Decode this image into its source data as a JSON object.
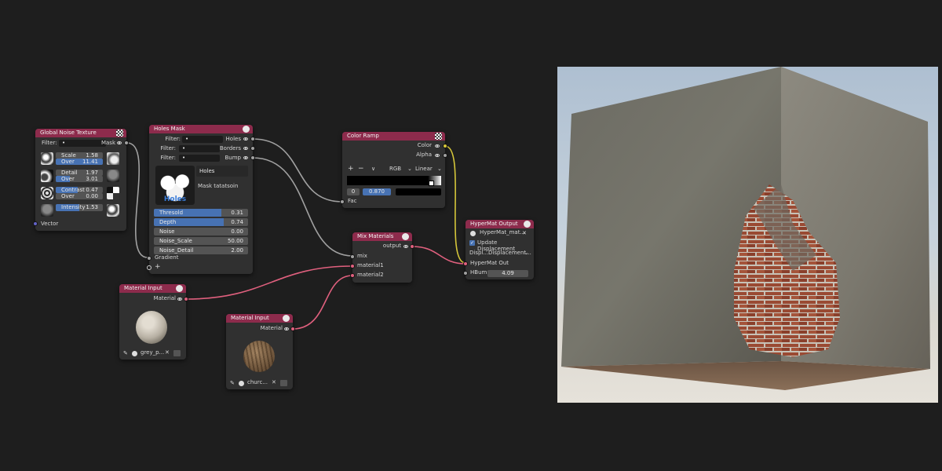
{
  "nodes": {
    "global_noise": {
      "title": "Global Noise Texture",
      "filter_label": "Filter:",
      "filter_value": "•",
      "mask_label": "Mask",
      "rows": [
        {
          "label1": "Scale",
          "value1": "1.58",
          "label2": "Over",
          "value2": "11.41"
        },
        {
          "label1": "Detail",
          "value1": "1.97",
          "label2": "Over",
          "value2": "3.01"
        },
        {
          "label1": "Contrast",
          "value1": "0.47",
          "label2": "Over",
          "value2": "0.00"
        },
        {
          "label1": "Intensity",
          "value1": "1.53"
        }
      ],
      "vector_label": "Vector"
    },
    "holes_mask": {
      "title": "Holes Mask",
      "filter_label": "Filter:",
      "filter_value": "•",
      "outputs": [
        "Holes",
        "Borders",
        "Bump"
      ],
      "preset_name": "Holes",
      "preset_overlay": "Holes",
      "preset_desc": "Mask tatatsoin",
      "params": [
        {
          "label": "Thresold",
          "value": "0.31",
          "fill": 0.72
        },
        {
          "label": "Depth",
          "value": "0.74",
          "fill": 0.74
        },
        {
          "label": "Noise",
          "value": "0.00",
          "fill": 0
        },
        {
          "label": "Noise_Scale",
          "value": "50.00",
          "fill": 0
        },
        {
          "label": "Noise_Detail",
          "value": "2.00",
          "fill": 0
        }
      ],
      "gradient_label": "Gradient",
      "add_label": "+"
    },
    "color_ramp": {
      "title": "Color Ramp",
      "out_color": "Color",
      "out_alpha": "Alpha",
      "plus": "+",
      "minus": "−",
      "chevron": "∨",
      "mode": "RGB",
      "interp": "Linear",
      "stop_index": "0",
      "stop_pos": "0.870",
      "fac_label": "Fac"
    },
    "mix_materials": {
      "title": "Mix Materials",
      "output_label": "output",
      "inputs": [
        "mix",
        "material1",
        "material2"
      ]
    },
    "material_input_1": {
      "title": "Material Input",
      "material_label": "Material",
      "material_name": "grey_p..."
    },
    "material_input_2": {
      "title": "Material Input",
      "material_label": "Material",
      "material_name": "churc..."
    },
    "hypermat_output": {
      "title": "HyperMat Output",
      "material_name": "HyperMat_mat...",
      "update_label": "Update Displacement",
      "displ_label": "Displ...",
      "displ_value": "Displacement...",
      "out_label": "HyperMat Out",
      "hbump_label": "HBump",
      "hbump_value": "4.09"
    }
  },
  "colors": {
    "node_header": "#8d2b4c",
    "wire_pink": "#e0607e",
    "wire_grey": "#a1a1a1",
    "wire_yellow": "#d6c73a",
    "slider_fill": "#4772b3"
  }
}
